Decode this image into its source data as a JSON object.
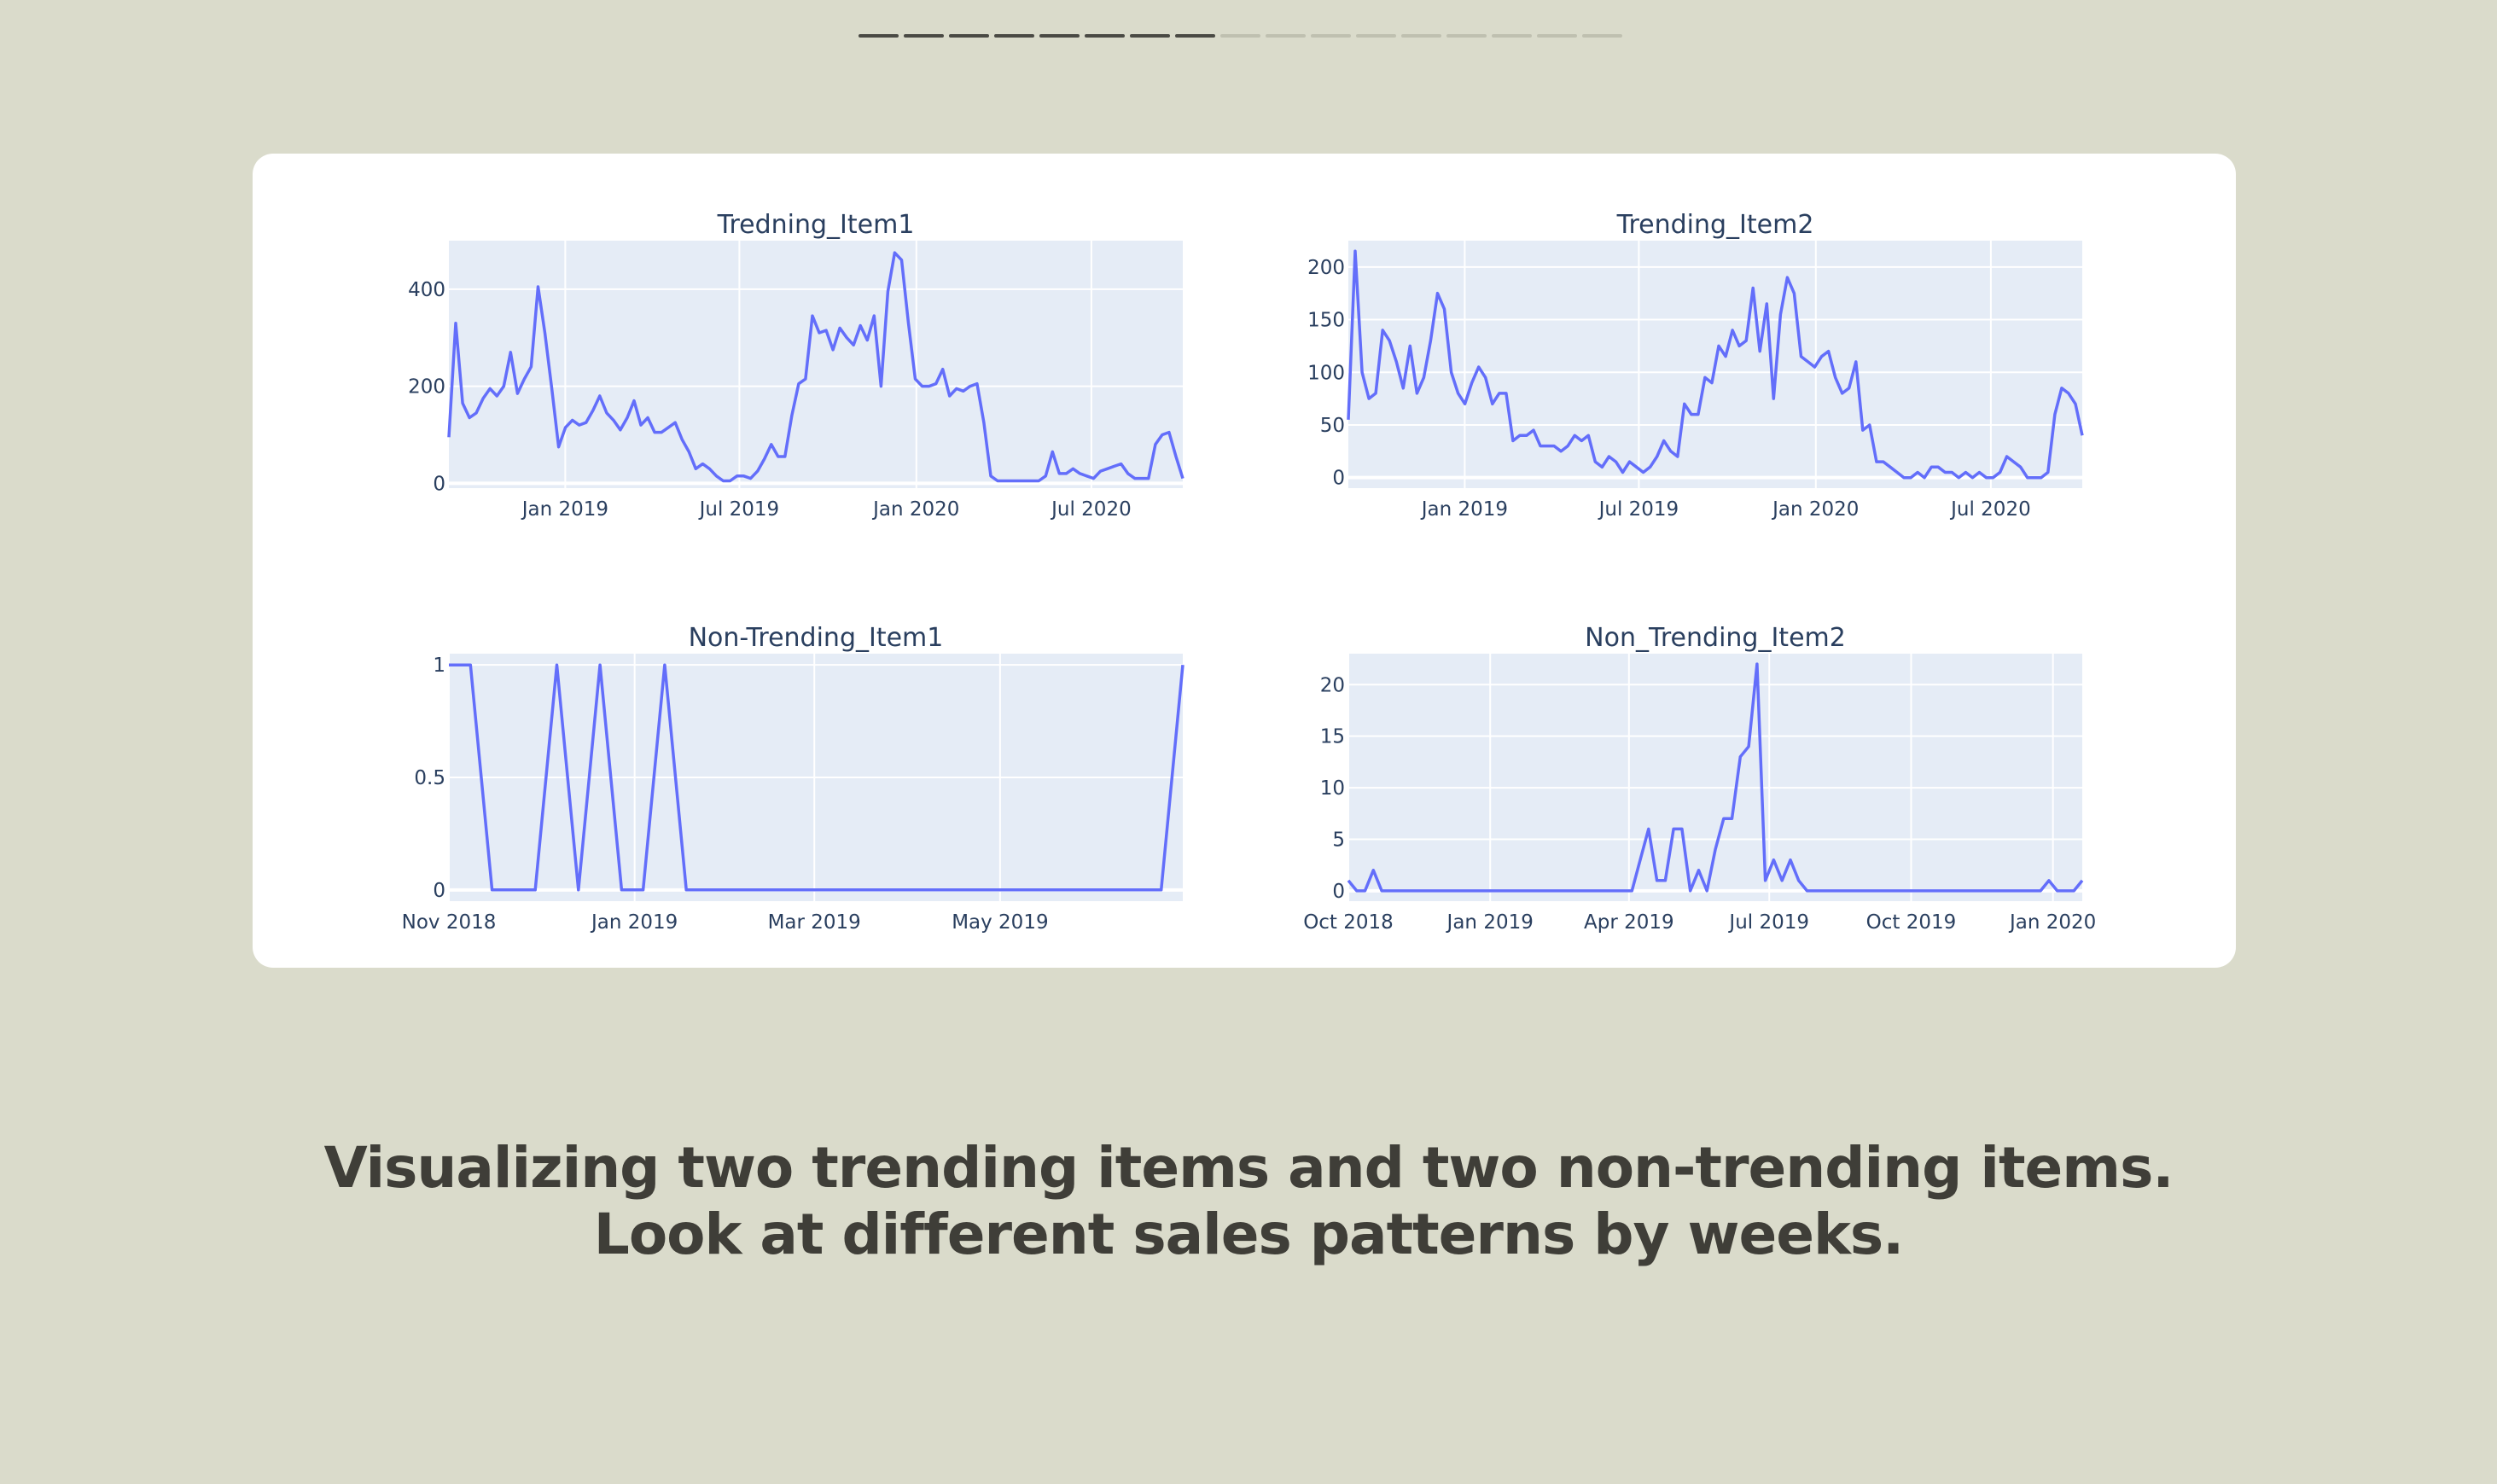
{
  "slide": {
    "progress": {
      "total": 17,
      "current": 8,
      "active_color": "#4a4a44",
      "inactive_color": "#bfc0b0"
    },
    "caption": "Visualizing two trending items and two non-trending items. Look at different sales patterns by weeks."
  },
  "chart_data": [
    {
      "type": "line",
      "title": "Tredning_Item1",
      "line_color": "#636efa",
      "plot_bg": "#e5ecf6",
      "grid": true,
      "x_start": "2018-09-02",
      "x_end": "2020-10-04",
      "xticks": [
        {
          "date": "2019-01-01",
          "label": "Jan 2019"
        },
        {
          "date": "2019-07-01",
          "label": "Jul 2019"
        },
        {
          "date": "2020-01-01",
          "label": "Jan 2020"
        },
        {
          "date": "2020-07-01",
          "label": "Jul 2020"
        }
      ],
      "ylim": [
        -10,
        500
      ],
      "yticks": [
        0,
        200,
        400
      ],
      "series": [
        {
          "values": [
            95,
            330,
            165,
            135,
            145,
            175,
            195,
            180,
            200,
            270,
            185,
            215,
            240,
            405,
            310,
            195,
            75,
            115,
            130,
            120,
            125,
            150,
            180,
            145,
            130,
            110,
            135,
            170,
            120,
            135,
            105,
            105,
            115,
            125,
            90,
            65,
            30,
            40,
            30,
            15,
            5,
            5,
            15,
            15,
            10,
            25,
            50,
            80,
            55,
            55,
            140,
            205,
            215,
            345,
            310,
            315,
            275,
            320,
            300,
            285,
            325,
            295,
            345,
            200,
            395,
            475,
            460,
            330,
            215,
            200,
            200,
            205,
            235,
            180,
            195,
            190,
            200,
            205,
            125,
            15,
            5,
            5,
            5,
            5,
            5,
            5,
            5,
            15,
            65,
            20,
            20,
            30,
            20,
            15,
            10,
            25,
            30,
            35,
            40,
            20,
            10,
            10,
            10,
            80,
            100,
            105,
            55,
            10
          ]
        }
      ]
    },
    {
      "type": "line",
      "title": "Trending_Item2",
      "line_color": "#636efa",
      "plot_bg": "#e5ecf6",
      "grid": true,
      "x_start": "2018-09-02",
      "x_end": "2020-10-04",
      "xticks": [
        {
          "date": "2019-01-01",
          "label": "Jan 2019"
        },
        {
          "date": "2019-07-01",
          "label": "Jul 2019"
        },
        {
          "date": "2020-01-01",
          "label": "Jan 2020"
        },
        {
          "date": "2020-07-01",
          "label": "Jul 2020"
        }
      ],
      "ylim": [
        -10,
        225
      ],
      "yticks": [
        0,
        50,
        100,
        150,
        200
      ],
      "series": [
        {
          "values": [
            55,
            215,
            100,
            75,
            80,
            140,
            130,
            110,
            85,
            125,
            80,
            95,
            130,
            175,
            160,
            100,
            80,
            70,
            90,
            105,
            95,
            70,
            80,
            80,
            35,
            40,
            40,
            45,
            30,
            30,
            30,
            25,
            30,
            40,
            35,
            40,
            15,
            10,
            20,
            15,
            5,
            15,
            10,
            5,
            10,
            20,
            35,
            25,
            20,
            70,
            60,
            60,
            95,
            90,
            125,
            115,
            140,
            125,
            130,
            180,
            120,
            165,
            75,
            155,
            190,
            175,
            115,
            110,
            105,
            115,
            120,
            95,
            80,
            85,
            110,
            45,
            50,
            15,
            15,
            10,
            5,
            0,
            0,
            5,
            0,
            10,
            10,
            5,
            5,
            0,
            5,
            0,
            5,
            0,
            0,
            5,
            20,
            15,
            10,
            0,
            0,
            0,
            5,
            60,
            85,
            80,
            70,
            40
          ]
        }
      ]
    },
    {
      "type": "line",
      "title": "Non-Trending_Item1",
      "line_color": "#636efa",
      "plot_bg": "#e5ecf6",
      "grid": true,
      "x_start": "2018-11-01",
      "x_end": "2019-06-30",
      "xticks": [
        {
          "date": "2018-11-01",
          "label": "Nov 2018"
        },
        {
          "date": "2019-01-01",
          "label": "Jan 2019"
        },
        {
          "date": "2019-03-01",
          "label": "Mar 2019"
        },
        {
          "date": "2019-05-01",
          "label": "May 2019"
        }
      ],
      "ylim": [
        -0.05,
        1.05
      ],
      "yticks": [
        {
          "value": 0,
          "label": "0"
        },
        {
          "value": 0.5,
          "label": "0.5"
        },
        {
          "value": 1,
          "label": "1"
        }
      ],
      "series": [
        {
          "values": [
            1,
            1,
            0,
            0,
            0,
            1,
            0,
            1,
            0,
            0,
            1,
            0,
            0,
            0,
            0,
            0,
            0,
            0,
            0,
            0,
            0,
            0,
            0,
            0,
            0,
            0,
            0,
            0,
            0,
            0,
            0,
            0,
            0,
            0,
            1
          ]
        }
      ]
    },
    {
      "type": "line",
      "title": "Non_Trending_Item2",
      "line_color": "#636efa",
      "plot_bg": "#e5ecf6",
      "grid": true,
      "x_start": "2018-10-01",
      "x_end": "2020-01-20",
      "xticks": [
        {
          "date": "2018-10-01",
          "label": "Oct 2018"
        },
        {
          "date": "2019-01-01",
          "label": "Jan 2019"
        },
        {
          "date": "2019-04-01",
          "label": "Apr 2019"
        },
        {
          "date": "2019-07-01",
          "label": "Jul 2019"
        },
        {
          "date": "2019-10-01",
          "label": "Oct 2019"
        },
        {
          "date": "2020-01-01",
          "label": "Jan 2020"
        }
      ],
      "ylim": [
        -1,
        23
      ],
      "yticks": [
        0,
        5,
        10,
        15,
        20
      ],
      "series": [
        {
          "values": [
            1,
            0,
            0,
            2,
            0,
            0,
            0,
            0,
            0,
            0,
            0,
            0,
            0,
            0,
            0,
            0,
            0,
            0,
            0,
            0,
            0,
            0,
            0,
            0,
            0,
            0,
            0,
            0,
            0,
            0,
            0,
            0,
            0,
            0,
            0,
            3,
            6,
            1,
            1,
            6,
            6,
            0,
            2,
            0,
            4,
            7,
            7,
            13,
            14,
            22,
            1,
            3,
            1,
            3,
            1,
            0,
            0,
            0,
            0,
            0,
            0,
            0,
            0,
            0,
            0,
            0,
            0,
            0,
            0,
            0,
            0,
            0,
            0,
            0,
            0,
            0,
            0,
            0,
            0,
            0,
            0,
            0,
            0,
            0,
            1,
            0,
            0,
            0,
            1
          ]
        }
      ]
    }
  ]
}
